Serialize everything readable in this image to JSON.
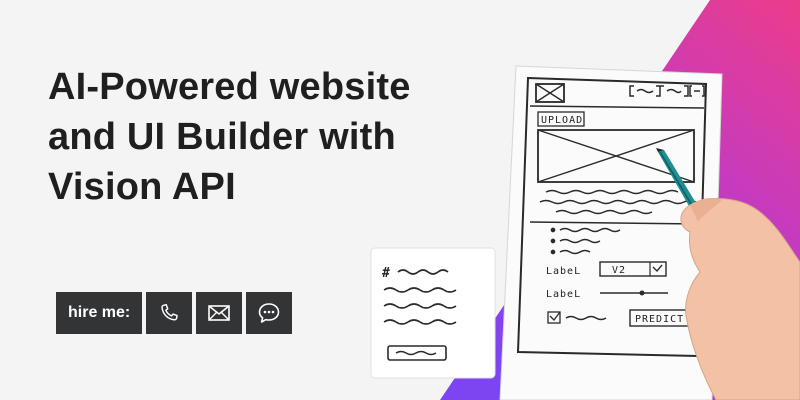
{
  "headline": {
    "line1": "AI-Powered website",
    "line2": "and UI Builder with",
    "line3": "Vision API"
  },
  "hire": {
    "label": "hire me:",
    "buttons": [
      "phone-icon",
      "mail-icon",
      "chat-icon"
    ]
  },
  "sketch": {
    "upload": "UPLOAD",
    "label1": "LabeL",
    "select_value": "V2",
    "label2": "LabeL",
    "predict": "PREDICT",
    "heading_mark": "#"
  },
  "colors": {
    "text": "#1f1f1f",
    "button_bg": "#333435",
    "gradient_pink": "#e63a8f",
    "gradient_purple": "#8a3ff0"
  }
}
